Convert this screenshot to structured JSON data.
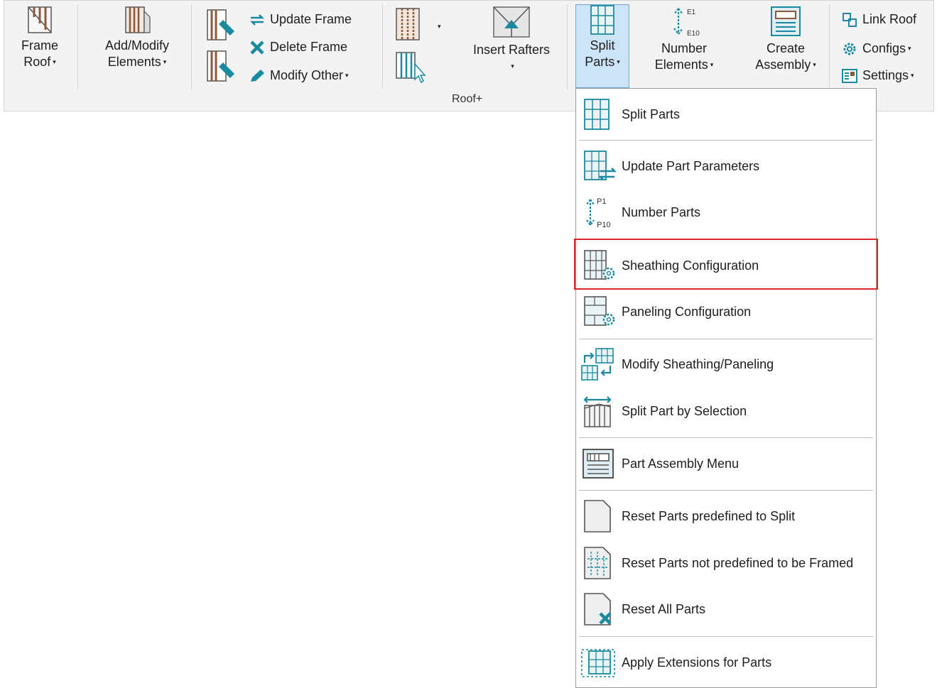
{
  "ribbon": {
    "group_label": "Roof+",
    "frame_roof": {
      "line1": "Frame",
      "line2": "Roof"
    },
    "add_modify": {
      "line1": "Add/Modify",
      "line2": "Elements"
    },
    "update_frame": "Update Frame",
    "delete_frame": "Delete Frame",
    "modify_other": "Modify Other",
    "insert_rafters": "Insert Rafters",
    "split_parts": {
      "line1": "Split",
      "line2": "Parts"
    },
    "number_elements": {
      "line1": "Number",
      "line2": "Elements",
      "icon_top": "E1",
      "icon_bottom": "E10"
    },
    "create_assembly": {
      "line1": "Create",
      "line2": "Assembly"
    },
    "link_roof": "Link Roof",
    "configs": "Configs",
    "settings": "Settings",
    "caret": "▾"
  },
  "menu": {
    "items": [
      {
        "label": "Split Parts"
      },
      {
        "label": "Update Part Parameters"
      },
      {
        "label": "Number Parts",
        "icon_top": "P1",
        "icon_bottom": "P10"
      },
      {
        "label": "Sheathing Configuration"
      },
      {
        "label": "Paneling Configuration"
      },
      {
        "label": "Modify Sheathing/Paneling"
      },
      {
        "label": "Split Part by Selection"
      },
      {
        "label": "Part Assembly Menu"
      },
      {
        "label": "Reset Parts predefined to Split"
      },
      {
        "label": "Reset Parts not predefined to be Framed"
      },
      {
        "label": "Reset All Parts"
      },
      {
        "label": "Apply Extensions for Parts"
      }
    ],
    "highlighted_item": "Sheathing Configuration"
  },
  "colors": {
    "accent": "#1a8aa0",
    "wood": "#8b5a3c",
    "highlight_border": "#d62828"
  }
}
